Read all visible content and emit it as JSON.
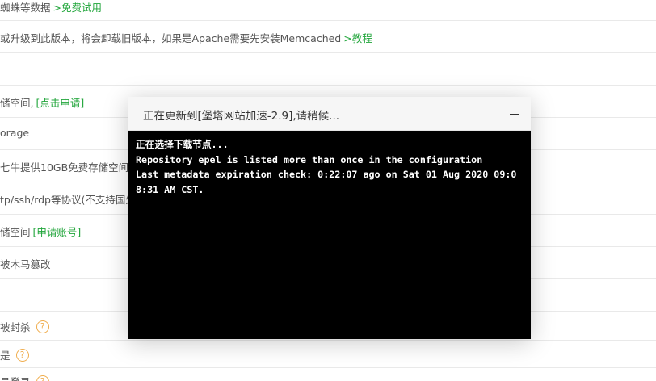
{
  "background_rows": [
    {
      "text": "蜘蛛等数据",
      "link": ">免费试用",
      "help": false
    },
    {
      "text": "或升级到此版本，将会卸载旧版本，如果是Apache需要先安装Memcached",
      "link": ">教程",
      "help": false
    },
    {
      "text": "",
      "link": "",
      "help": false
    },
    {
      "text": "储空间,",
      "link": "[点击申请]",
      "help": false
    },
    {
      "text": "orage",
      "link": "",
      "help": false
    },
    {
      "text": "七牛提供10GB免费存储空间,",
      "link": "",
      "help": false
    },
    {
      "text": "tp/ssh/rdp等协议(不支持国外",
      "link": "",
      "help": false
    },
    {
      "text": "储空间",
      "link": "[申请账号]",
      "help": false
    },
    {
      "text": "被木马篡改",
      "link": "",
      "help": false
    },
    {
      "text": "",
      "link": "",
      "help": false
    },
    {
      "text": "被封杀",
      "link": "",
      "help": true
    },
    {
      "text": "是",
      "link": "",
      "help": true
    },
    {
      "text": "员登录",
      "link": "",
      "help": true
    }
  ],
  "dialog": {
    "title": "正在更新到[堡塔网站加速-2.9],请稍候...",
    "minimize_icon": "minimize-icon",
    "terminal_lines": [
      "正在选择下载节点...",
      "Repository epel is listed more than once in the configuration",
      "Last metadata expiration check: 0:22:07 ago on Sat 01 Aug 2020 09:0",
      "8:31 AM CST."
    ]
  },
  "colors": {
    "link_green": "#20a53a",
    "help_orange": "#f0ad4e",
    "terminal_bg": "#000000",
    "terminal_fg": "#ffffff"
  },
  "help_icon_glyph": "?"
}
